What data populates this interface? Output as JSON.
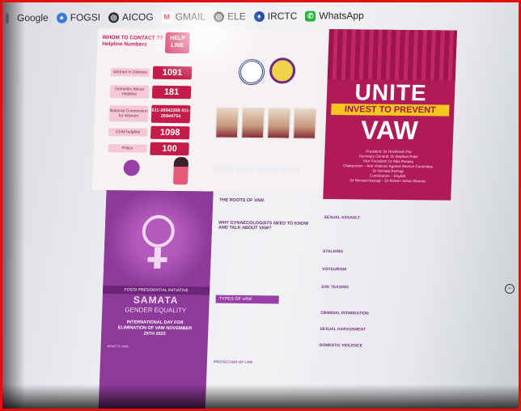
{
  "bookmarks": [
    {
      "label": "Google",
      "icon": "folder-icon"
    },
    {
      "label": "FOGSI",
      "icon": "globe-icon"
    },
    {
      "label": "AICOG",
      "icon": "globe-icon"
    },
    {
      "label": "GMAIL",
      "icon": "gmail-icon"
    },
    {
      "label": "ELE",
      "icon": "globe-icon"
    },
    {
      "label": "IRCTC",
      "icon": "irctc-icon"
    },
    {
      "label": "WhatsApp",
      "icon": "whatsapp-icon"
    }
  ],
  "poster1": {
    "who_to_contact": "WHOM TO CONTACT ?? Helpline Numbers",
    "helpline_badge": "HELP LINE",
    "rows": [
      {
        "label": "Women in Distress",
        "number": "1091"
      },
      {
        "label": "Domestic Abuse Helpline",
        "number": "181"
      },
      {
        "label": "National Commission for Women",
        "number": "011-26942369 011-26944754"
      },
      {
        "label": "Child helpline",
        "number": "1098"
      },
      {
        "label": "Police",
        "number": "100"
      }
    ]
  },
  "poster2": {
    "headline1": "UNITE",
    "band": "INVEST TO PREVENT",
    "headline2": "VAW",
    "credits": [
      "President: Dr Hrishikesh Pai",
      "Secretary General: Dr Madhuri Patel",
      "Vice President: Dr Alka Pandey",
      "Chairperson – Anti Violence Against Women Committee",
      "Dr Nirmala Rastogi",
      "Contributors – English",
      "Dr Nirmala Rastogi – Dr Ashwin Sahai Sharma"
    ]
  },
  "poster3": {
    "band": "FOGSI PRESIDENTIAL INITIATIVE",
    "title": "SAMATA",
    "subtitle": "GENDER EQUALITY",
    "intday": "INTERNATIONAL DAY FOR ELIMINATION OF VAW NOVEMBER 25TH 2023",
    "whatis": "WHAT IS VAW..."
  },
  "article": {
    "roots": "THE ROOTS OF VAW",
    "why": "WHY GYNAECOLOGISTS NEED TO KNOW AND TALK ABOUT VAW?",
    "types": "TYPES OF VAW",
    "protection": "PROTECTION OF LAW"
  },
  "column3": {
    "sexual": "SEXUAL ASSAULT",
    "stalking": "STALKING",
    "voyeurism": "VOYEURISM",
    "eve": "EVE TEASING",
    "criminal": "CRIMINAL INTIMIDATION",
    "sexual_h": "SEXUAL HARASSMENT",
    "domestic": "DOMESTIC VIOLENCE"
  }
}
